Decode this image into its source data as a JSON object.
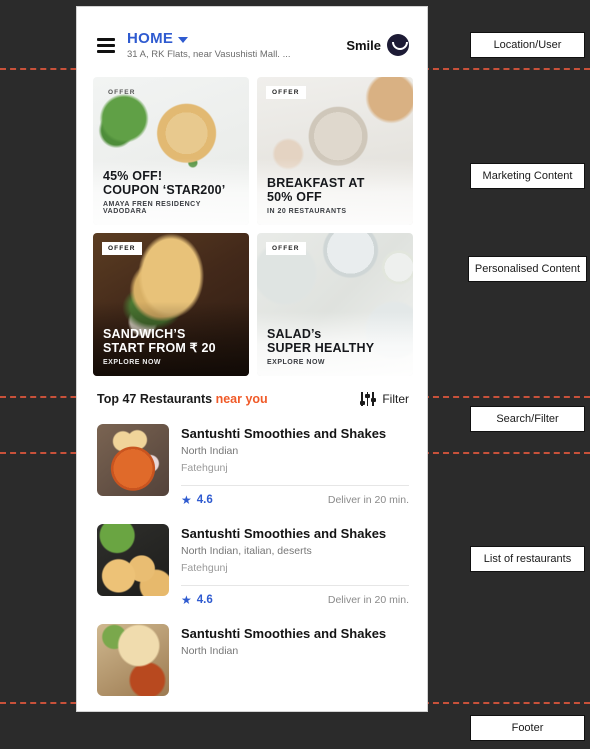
{
  "header": {
    "menu_icon": "hamburger-menu-icon",
    "location_label": "HOME",
    "chevron_icon": "chevron-down-icon",
    "address": "31 A, RK Flats,  near Vasushisti Mall. ...",
    "user_name": "Smile",
    "avatar_icon": "smiley-avatar-icon"
  },
  "promos": [
    {
      "badge": "OFFER",
      "title": "45% OFF!\nCOUPON ‘STAR200’",
      "title_line1": "45% OFF!",
      "title_line2": "COUPON ‘STAR200’",
      "subtitle": "AMAYA FREN RESIDENCY VADODARA",
      "theme": "light",
      "art": "pizza"
    },
    {
      "badge": "OFFER",
      "title_line1": "BREAKFAST AT",
      "title_line2": "50% OFF",
      "subtitle": "IN 20 RESTAURANTS",
      "theme": "light",
      "art": "breakfast-bowl"
    },
    {
      "badge": "OFFER",
      "title_line1": "SANDWICH’S",
      "title_line2": "START FROM ₹ 20",
      "subtitle": "EXPLORE NOW",
      "theme": "dark",
      "art": "sandwich"
    },
    {
      "badge": "OFFER",
      "title_line1": "SALAD’s",
      "title_line2": "SUPER HEALTHY",
      "subtitle": "EXPLORE NOW",
      "theme": "light",
      "art": "salad"
    }
  ],
  "filter_bar": {
    "title": "Top 47 Restaurants",
    "accent_text": "near you",
    "filter_label": "Filter",
    "filter_icon": "sliders-icon"
  },
  "restaurants": [
    {
      "name": "Santushti Smoothies and Shakes",
      "cuisine": "North Indian",
      "area": "Fatehgunj",
      "star_icon": "star-icon",
      "rating": "4.6",
      "delivery": "Deliver in 20 min."
    },
    {
      "name": "Santushti Smoothies and Shakes",
      "cuisine": "North Indian, italian, deserts",
      "area": "Fatehgunj",
      "star_icon": "star-icon",
      "rating": "4.6",
      "delivery": "Deliver in 20 min."
    },
    {
      "name": "Santushti Smoothies and Shakes",
      "cuisine": "North Indian",
      "area": "",
      "star_icon": "star-icon",
      "rating": "",
      "delivery": ""
    }
  ],
  "annotations": [
    {
      "label": "Location/User"
    },
    {
      "label": "Marketing Content"
    },
    {
      "label": "Personalised Content"
    },
    {
      "label": "Search/Filter"
    },
    {
      "label": "List of restaurants"
    },
    {
      "label": "Footer"
    }
  ],
  "colors": {
    "accent": "#f05a28",
    "brand_blue": "#2f5bd0",
    "dash_rule": "#c8513a",
    "backdrop": "#2b2b2b"
  }
}
